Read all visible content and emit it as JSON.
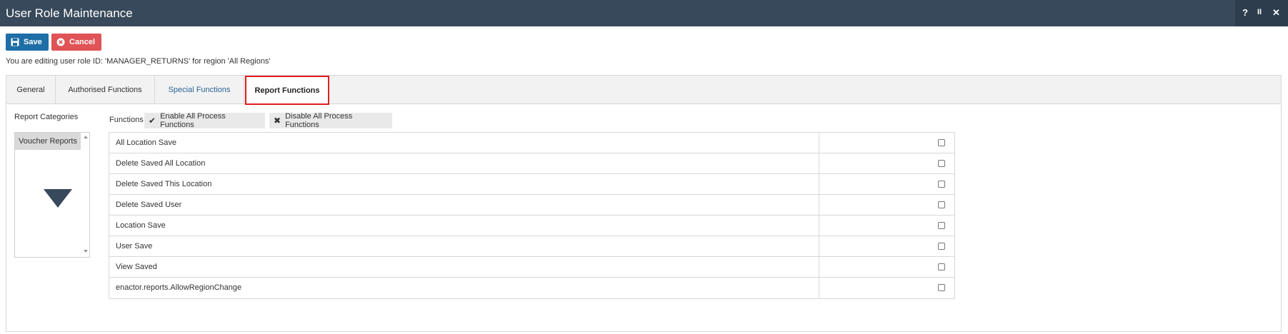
{
  "window": {
    "title": "User Role Maintenance",
    "controls": [
      "?",
      "II",
      "✕"
    ]
  },
  "toolbar": {
    "save_label": "Save",
    "cancel_label": "Cancel"
  },
  "info_text": "You are editing user role ID: 'MANAGER_RETURNS' for region 'All Regions'",
  "tabs": [
    {
      "label": "General"
    },
    {
      "label": "Authorised Functions"
    },
    {
      "label": "Special Functions"
    },
    {
      "label": "Report Functions",
      "active": true
    }
  ],
  "categories": {
    "label": "Report Categories",
    "items": [
      "Voucher Reports"
    ]
  },
  "functions": {
    "label": "Functions",
    "enable_all_label": "Enable All Process Functions",
    "disable_all_label": "Disable All Process Functions",
    "rows": [
      {
        "name": "All Location Save",
        "checked": false
      },
      {
        "name": "Delete Saved All Location",
        "checked": false
      },
      {
        "name": "Delete Saved This Location",
        "checked": false
      },
      {
        "name": "Delete Saved User",
        "checked": false
      },
      {
        "name": "Location Save",
        "checked": false
      },
      {
        "name": "User Save",
        "checked": false
      },
      {
        "name": "View Saved",
        "checked": false
      },
      {
        "name": "enactor.reports.AllowRegionChange",
        "checked": false
      }
    ]
  },
  "colors": {
    "titlebar": "#37495b",
    "save_button": "#1e6ea7",
    "cancel_button": "#e05356",
    "active_tab_highlight": "#e01f1f"
  }
}
